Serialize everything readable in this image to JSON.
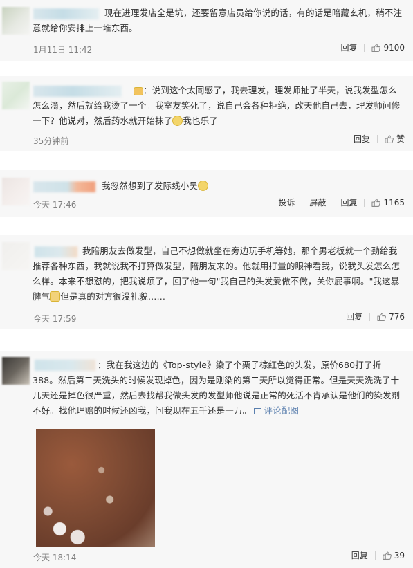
{
  "comments": [
    {
      "text": "现在进理发店全是坑，还要留意店员给你说的话，有的话是暗藏玄机，稍不注意就给你安排上一堆东西。",
      "time": "1月11日 11:42",
      "reply": "回复",
      "likes": "9100"
    },
    {
      "text_a": "：说到这个太同感了，我去理发，理发师扯了半天，说我发型怎么怎么滴，然后就给我烫了一个。我室友笑死了，说自己会各种拒绝，改天他自己去，理发师问修一下？他说对，然后药水就开始抹了",
      "text_b": "我也乐了",
      "time": "35分钟前",
      "reply": "回复",
      "likes": "赞"
    },
    {
      "text": "我忽然想到了发际线小吴",
      "time": "今天 17:46",
      "report": "投诉",
      "block": "屏蔽",
      "reply": "回复",
      "likes": "1165"
    },
    {
      "text_a": "我陪朋友去做发型，自己不想做就坐在旁边玩手机等她，那个男老板就一个劲给我推荐各种东西，我就说我不打算做发型，陪朋友来的。他就用打量的眼神看我，说我头发怎么怎么样。本来不想怼的，把我说烦了，回了他一句\"我自己的头发爱做不做，关你屁事啊。\"我这暴脾气",
      "text_b": "但是真的对方很没礼貌……",
      "time": "今天 17:59",
      "reply": "回复",
      "likes": "776"
    },
    {
      "text": "：我在我这边的《Top-style》染了个栗子棕红色的头发，原价680打了折388。然后第二天洗头的时候发现掉色，因为是刚染的第二天所以觉得正常。但是天天洗洗了十几天还是掉色很严重，然后去找帮我做头发的发型师他说是正常的死活不肯承认是他们的染发剂不好。找他理赔的时候还凶我，问我现在五千还是一万。",
      "link": "评论配图",
      "time": "今天 18:14",
      "reply": "回复",
      "likes": "39"
    }
  ],
  "colors": {
    "card_bg": "#f7f7f7",
    "text": "#333333",
    "meta": "#808080",
    "link": "#5a7fae"
  }
}
